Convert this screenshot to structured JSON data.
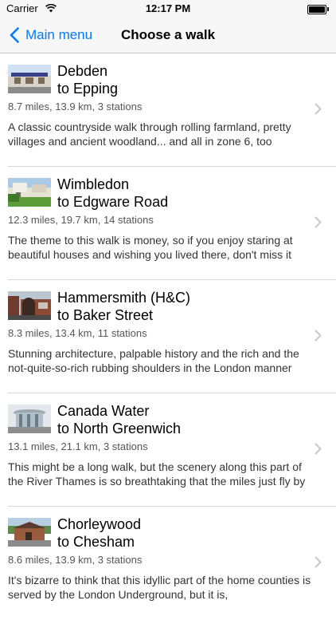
{
  "status": {
    "carrier": "Carrier",
    "time": "12:17 PM"
  },
  "nav": {
    "back_label": "Main menu",
    "title": "Choose a walk"
  },
  "walks": [
    {
      "from": "Debden",
      "to": "to Epping",
      "stats": "8.7 miles, 13.9 km, 3 stations",
      "description": "A classic countryside walk through rolling farmland, pretty villages and ancient woodland... and all in zone 6, too"
    },
    {
      "from": "Wimbledon",
      "to": "to Edgware Road",
      "stats": "12.3 miles, 19.7 km, 14 stations",
      "description": "The theme to this walk is money, so if you enjoy staring at beautiful houses and wishing you lived there, don't miss it"
    },
    {
      "from": "Hammersmith (H&C)",
      "to": "to Baker Street",
      "stats": "8.3 miles, 13.4 km, 11 stations",
      "description": "Stunning architecture, palpable history and the rich and the not-quite-so-rich rubbing shoulders in the London manner"
    },
    {
      "from": "Canada Water",
      "to": "to North Greenwich",
      "stats": "13.1 miles, 21.1 km, 3 stations",
      "description": "This might be a long walk, but the scenery along this part of the River Thames is so breathtaking that the miles just fly by"
    },
    {
      "from": "Chorleywood",
      "to": "to Chesham",
      "stats": "8.6 miles, 13.9 km, 3 stations",
      "description": "It's bizarre to think that this idyllic part of the home counties is served by the London Underground, but it is,"
    }
  ],
  "colors": {
    "accent": "#007aff",
    "nav_bg": "#f7f7f7",
    "separator": "#d8d8dc"
  }
}
